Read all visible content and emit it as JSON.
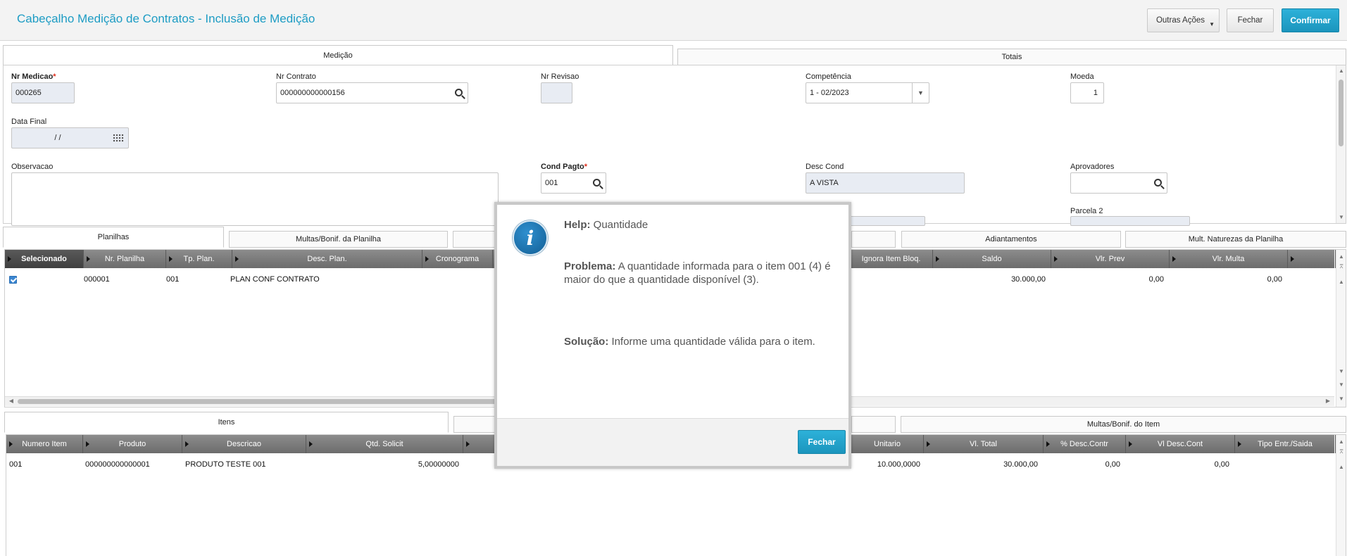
{
  "header": {
    "title": "Cabeçalho Medição de Contratos - Inclusão de Medição",
    "buttons": {
      "other_actions": "Outras Ações",
      "close": "Fechar",
      "confirm": "Confirmar"
    }
  },
  "top_tabs": [
    "Medição",
    "Totais"
  ],
  "form": {
    "nr_medicao": {
      "label": "Nr Medicao",
      "required": "*",
      "value": "000265"
    },
    "nr_contrato": {
      "label": "Nr Contrato",
      "value": "000000000000156"
    },
    "nr_revisao": {
      "label": "Nr Revisao",
      "value": ""
    },
    "competencia": {
      "label": "Competência",
      "value": "1 - 02/2023"
    },
    "moeda": {
      "label": "Moeda",
      "value": "1"
    },
    "data_final": {
      "label": "Data Final",
      "value": "/ /"
    },
    "observacao": {
      "label": "Observacao",
      "value": ""
    },
    "cond_pagto": {
      "label": "Cond Pagto",
      "required": "*",
      "value": "001"
    },
    "desc_cond": {
      "label": "Desc Cond",
      "value": "A VISTA"
    },
    "aprovadores": {
      "label": "Aprovadores",
      "value": ""
    },
    "parcela2": {
      "label": "Parcela 2"
    }
  },
  "mid_tabs": [
    "Planilhas",
    "Multas/Bonif. da Planilha",
    "Adiantamentos",
    "Mult. Naturezas da Planilha"
  ],
  "planilhas_grid": {
    "columns_left": [
      "Selecionado",
      "Nr. Planilha",
      "Tp. Plan.",
      "Desc. Plan.",
      "Cronograma"
    ],
    "columns_right": [
      "Ignora Item Bloq.",
      "Saldo",
      "Vlr. Prev",
      "Vlr. Multa"
    ],
    "row": {
      "nr_planilha": "000001",
      "tp_plan": "001",
      "desc_plan": "PLAN CONF CONTRATO",
      "saldo": "30.000,00",
      "vlr_prev": "0,00",
      "vlr_multa": "0,00"
    }
  },
  "bottom_tabs": [
    "Itens",
    "Multas/Bonif. do Item"
  ],
  "itens_grid": {
    "columns_left": [
      "Numero Item",
      "Produto",
      "Descricao",
      "Qtd. Solicit"
    ],
    "columns_right": [
      "Unitario",
      "Vl. Total",
      "% Desc.Contr",
      "Vl Desc.Cont",
      "Tipo Entr./Saida"
    ],
    "row": {
      "numero_item": "001",
      "produto": "000000000000001",
      "descricao": "PRODUTO TESTE 001",
      "qtd_solicit": "5,00000000",
      "unitario": "10.000,0000",
      "vl_total": "30.000,00",
      "pct_desc": "0,00",
      "vl_desc": "0,00"
    }
  },
  "modal": {
    "help_label": "Help:",
    "help_value": "Quantidade",
    "problem_label": "Problema:",
    "problem_text": "A quantidade informada para o item 001 (4) é maior do que a quantidade disponível (3).",
    "solution_label": "Solução:",
    "solution_text": "Informe uma quantidade válida para o item.",
    "close_button": "Fechar"
  }
}
